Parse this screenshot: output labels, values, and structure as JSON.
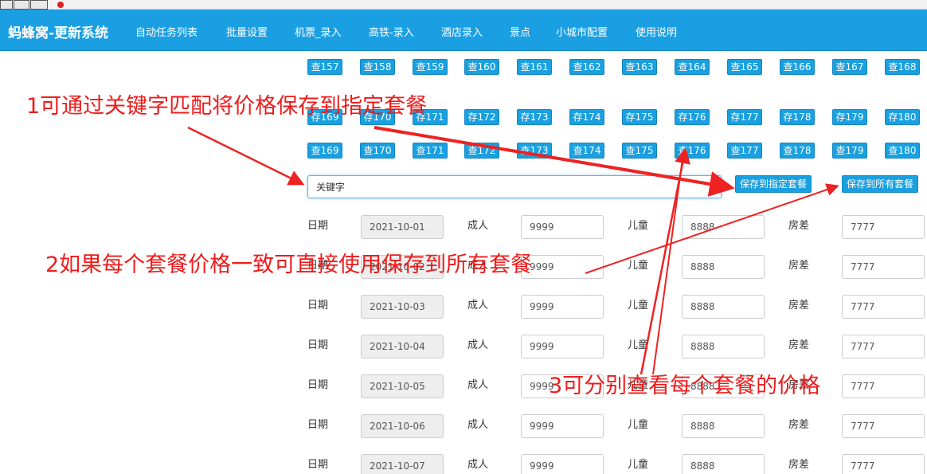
{
  "toolbar_icons": [
    "moon-icon",
    "window-icon",
    "keyboard-icon"
  ],
  "navbar": {
    "brand": "蚂蜂窝-更新系统",
    "items": [
      "自动任务列表",
      "批量设置",
      "机票_录入",
      "高铁-录入",
      "酒店录入",
      "景点",
      "小城市配置",
      "使用说明"
    ]
  },
  "view_buttons_row1": [
    "查157",
    "查158",
    "查159",
    "查160",
    "查161",
    "查162",
    "查163",
    "查164",
    "查165",
    "查166",
    "查167",
    "查168"
  ],
  "save_buttons_row": [
    "存169",
    "存170",
    "存171",
    "存172",
    "存173",
    "存174",
    "存175",
    "存176",
    "存177",
    "存178",
    "存179",
    "存180"
  ],
  "view_buttons_row2": [
    "查169",
    "查170",
    "查171",
    "查172",
    "查173",
    "查174",
    "查175",
    "查176",
    "查177",
    "查178",
    "查179",
    "查180"
  ],
  "keyword": {
    "value": "关键字"
  },
  "actions": {
    "save_specified": "保存到指定套餐",
    "save_all": "保存到所有套餐"
  },
  "labels": {
    "date": "日期",
    "adult": "成人",
    "child": "儿童",
    "room": "房差"
  },
  "rows": [
    {
      "date": "2021-10-01",
      "adult": "9999",
      "child": "8888",
      "room": "7777"
    },
    {
      "date": "2021-10-02",
      "adult": "9999",
      "child": "8888",
      "room": "7777"
    },
    {
      "date": "2021-10-03",
      "adult": "9999",
      "child": "8888",
      "room": "7777"
    },
    {
      "date": "2021-10-04",
      "adult": "9999",
      "child": "8888",
      "room": "7777"
    },
    {
      "date": "2021-10-05",
      "adult": "9999",
      "child": "8888",
      "room": "7777"
    },
    {
      "date": "2021-10-06",
      "adult": "9999",
      "child": "8888",
      "room": "7777"
    },
    {
      "date": "2021-10-07",
      "adult": "9999",
      "child": "8888",
      "room": "7777"
    }
  ],
  "annotations": {
    "note1": "1可通过关键字匹配将价格保存到指定套餐",
    "note2": "2如果每个套餐价格一致可直接使用保存到所有套餐",
    "note3": "3可分别查看每个套餐的价格"
  },
  "colors": {
    "nav": "#1b9fe3",
    "button": "#1aa0e0",
    "annotation": "#ee1c1c"
  }
}
